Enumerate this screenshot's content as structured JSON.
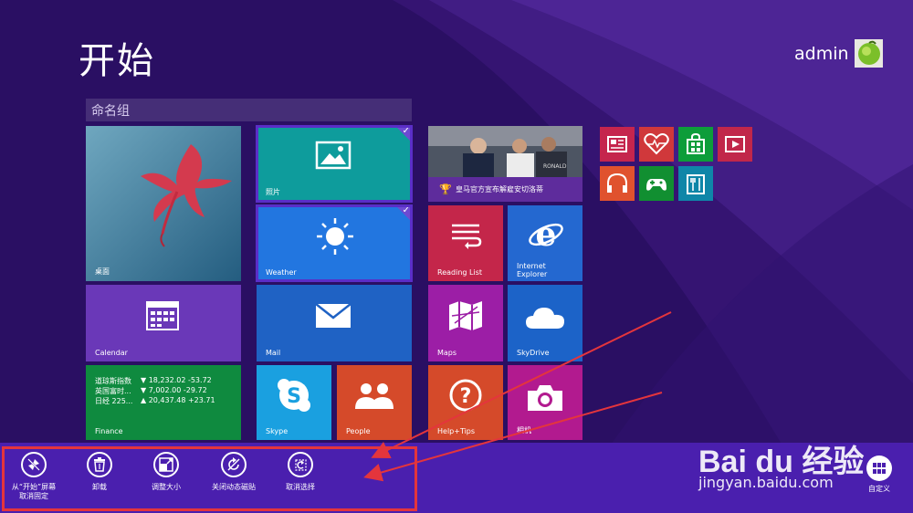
{
  "start": {
    "title": "开始"
  },
  "user": {
    "name": "admin"
  },
  "group": {
    "name": "命名组"
  },
  "tiles": {
    "desktop": {
      "label": "桌面"
    },
    "photos": {
      "label": "照片"
    },
    "weather": {
      "label": "Weather"
    },
    "news": {
      "caption": "皇马官方宣布解雇安切洛蒂"
    },
    "reading_list": {
      "label": "Reading List"
    },
    "ie": {
      "label": "Internet\nExplorer"
    },
    "calendar": {
      "label": "Calendar"
    },
    "mail": {
      "label": "Mail"
    },
    "maps": {
      "label": "Maps"
    },
    "skydrive": {
      "label": "SkyDrive"
    },
    "finance": {
      "label": "Finance",
      "rows": [
        {
          "name": "道琼斯指数",
          "value": "▼ 18,232.02 -53.72"
        },
        {
          "name": "英国富时...",
          "value": "▼ 7,002.00 -29.72"
        },
        {
          "name": "日经 225...",
          "value": "▲ 20,437.48 +23.71"
        }
      ]
    },
    "skype": {
      "label": "Skype"
    },
    "people": {
      "label": "People"
    },
    "help": {
      "label": "Help+Tips"
    },
    "camera": {
      "label": "相机"
    }
  },
  "small_tiles": [
    {
      "name": "news-app",
      "color": "#c5254d",
      "icon": "newspaper-icon"
    },
    {
      "name": "health-app",
      "color": "#d0383b",
      "icon": "heart-pulse-icon"
    },
    {
      "name": "store-app",
      "color": "#0d9d3a",
      "icon": "store-bag-icon"
    },
    {
      "name": "video-app",
      "color": "#c1274a",
      "icon": "video-icon"
    },
    {
      "name": "music-app",
      "color": "#e0522e",
      "icon": "headphones-icon"
    },
    {
      "name": "games-app",
      "color": "#118f31",
      "icon": "gamepad-icon"
    },
    {
      "name": "food-app",
      "color": "#0f86a8",
      "icon": "fork-knife-icon"
    }
  ],
  "app_bar": {
    "buttons": [
      {
        "label": "从“开始”屏幕\n取消固定",
        "icon": "unpin-icon"
      },
      {
        "label": "卸载",
        "icon": "trash-icon"
      },
      {
        "label": "调整大小",
        "icon": "resize-icon"
      },
      {
        "label": "关闭动态磁贴",
        "icon": "live-tile-off-icon"
      },
      {
        "label": "取消选择",
        "icon": "clear-selection-icon"
      }
    ],
    "customize_label": "自定义"
  },
  "watermark": {
    "logo": "Bai du 经验",
    "url": "jingyan.baidu.com"
  },
  "colors": {
    "background": "#2a0f63",
    "app_bar": "#4a1fae",
    "annotation": "#e4353c"
  }
}
